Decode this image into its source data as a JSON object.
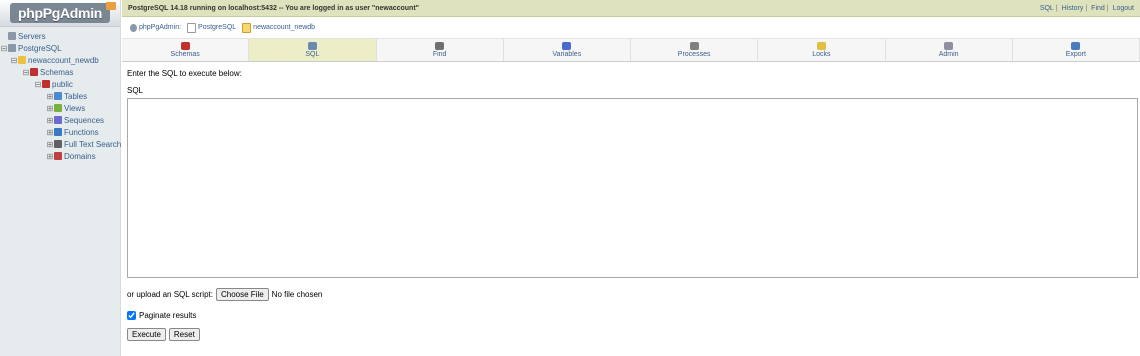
{
  "sidebar": {
    "logo": "phpPgAdmin",
    "tree": [
      {
        "label": "Servers",
        "expander": "",
        "icon": "server-group-icon",
        "color": "#8a98a8"
      },
      {
        "label": "PostgreSQL",
        "expander": "⊟",
        "icon": "server-icon",
        "color": "#8a98a8"
      },
      {
        "label": "newaccount_newdb",
        "expander": "⊟",
        "icon": "database-icon",
        "color": "#f0c040"
      },
      {
        "label": "Schemas",
        "expander": "⊟",
        "icon": "schemas-icon",
        "color": "#c03030"
      },
      {
        "label": "public",
        "expander": "⊟",
        "icon": "schema-icon",
        "color": "#c03030"
      },
      {
        "label": "Tables",
        "expander": "⊞",
        "icon": "tables-icon",
        "color": "#4a8ad0"
      },
      {
        "label": "Views",
        "expander": "⊞",
        "icon": "views-icon",
        "color": "#7ab040"
      },
      {
        "label": "Sequences",
        "expander": "⊞",
        "icon": "sequences-icon",
        "color": "#6a6ad0"
      },
      {
        "label": "Functions",
        "expander": "⊞",
        "icon": "functions-icon",
        "color": "#3a7ac0"
      },
      {
        "label": "Full Text Search",
        "expander": "⊞",
        "icon": "fts-icon",
        "color": "#606060"
      },
      {
        "label": "Domains",
        "expander": "⊞",
        "icon": "domains-icon",
        "color": "#c04040"
      }
    ]
  },
  "topbar": {
    "status": "PostgreSQL 14.18 running on localhost:5432 -- You are logged in as user \"newaccount\"",
    "links": [
      "SQL",
      "History",
      "Find",
      "Logout"
    ]
  },
  "trail": [
    {
      "label": "phpPgAdmin:",
      "icon": "phppgadmin-icon"
    },
    {
      "label": "PostgreSQL",
      "icon": "server-icon"
    },
    {
      "label": "newaccount_newdb",
      "icon": "database-icon"
    }
  ],
  "tabs": [
    {
      "label": "Schemas",
      "icon": "schemas-icon",
      "color": "#c03030",
      "active": false
    },
    {
      "label": "SQL",
      "icon": "sql-icon",
      "color": "#6a8ab0",
      "active": true
    },
    {
      "label": "Find",
      "icon": "find-icon",
      "color": "#707070",
      "active": false
    },
    {
      "label": "Variables",
      "icon": "variables-icon",
      "color": "#4a6ad0",
      "active": false
    },
    {
      "label": "Processes",
      "icon": "processes-icon",
      "color": "#808080",
      "active": false
    },
    {
      "label": "Locks",
      "icon": "locks-icon",
      "color": "#e0c040",
      "active": false
    },
    {
      "label": "Admin",
      "icon": "admin-icon",
      "color": "#9090a0",
      "active": false
    },
    {
      "label": "Export",
      "icon": "export-icon",
      "color": "#4a7ac0",
      "active": false
    }
  ],
  "form": {
    "instruction": "Enter the SQL to execute below:",
    "sql_label": "SQL",
    "sql_value": "",
    "upload_label": "or upload an SQL script:",
    "choose_file": "Choose File",
    "no_file": "No file chosen",
    "paginate_label": "Paginate results",
    "paginate_checked": true,
    "execute": "Execute",
    "reset": "Reset"
  }
}
